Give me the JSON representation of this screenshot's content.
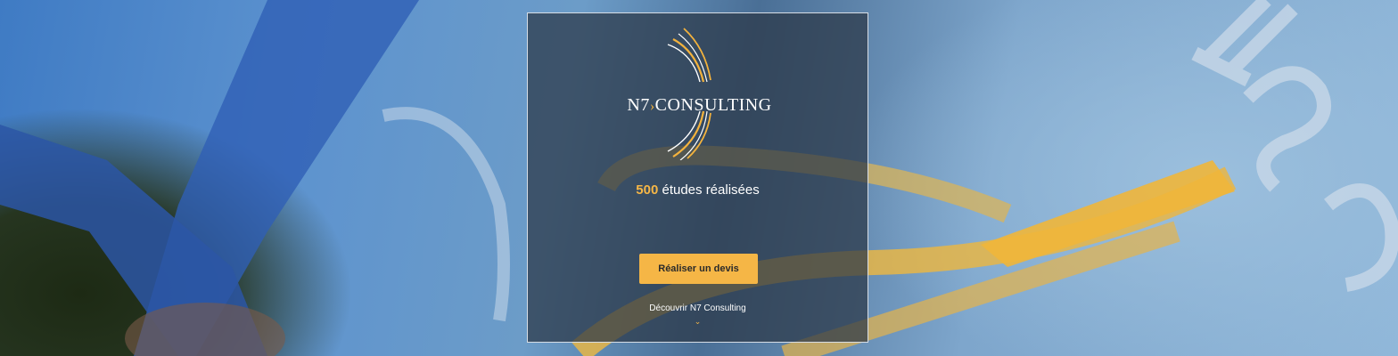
{
  "logo": {
    "name_part1": "N7",
    "arrow": "›",
    "name_part2": "CONSULTING"
  },
  "stats": {
    "count": "500",
    "label": "études réalisées"
  },
  "cta": {
    "label": "Réaliser un devis"
  },
  "discover": {
    "label": "Découvrir N7 Consulting",
    "icon": "chevron-down-icon",
    "glyph": "⌄"
  },
  "colors": {
    "accent": "#f5b646",
    "panel": "#2b3746",
    "panel_border": "#d7dde5"
  }
}
